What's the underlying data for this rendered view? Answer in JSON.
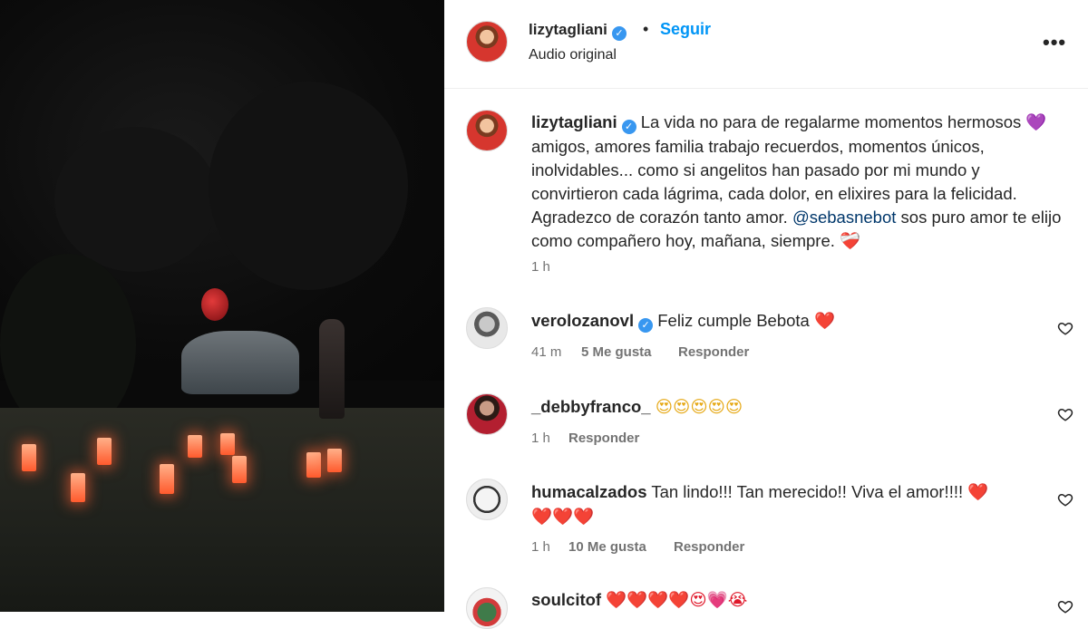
{
  "post": {
    "username": "lizytagliani",
    "follow_label": "Seguir",
    "separator": "•",
    "audio_label": "Audio original",
    "more_label": "•••",
    "caption_part1": "La vida no para de regalarme momentos hermosos",
    "caption_heart": "💜",
    "caption_part2": "amigos, amores familia trabajo recuerdos, momentos únicos, inolvidables... como si angelitos han pasado por mi mundo y convirtieron cada lágrima, cada dolor, en elixires para la felicidad. Agradezco de corazón tanto amor.",
    "caption_mention": "@sebasnebot",
    "caption_part3": "sos puro amor te elijo como compañero hoy, mañana, siempre.",
    "caption_end": "❤️‍🩹",
    "caption_time": "1 h"
  },
  "comments": [
    {
      "username": "verolozanovl",
      "verified": true,
      "text": "Feliz cumple Bebota",
      "emoji": "❤️",
      "time": "41 m",
      "likes": "5 Me gusta",
      "reply": "Responder"
    },
    {
      "username": "_debbyfranco_",
      "verified": false,
      "text": "",
      "emoji": "😍😍😍😍😍",
      "time": "1 h",
      "likes": "",
      "reply": "Responder"
    },
    {
      "username": "humacalzados",
      "verified": false,
      "text": "Tan lindo!!! Tan merecido!! Viva el amor!!!!",
      "emoji": "❤️",
      "emoji_line2": "❤️❤️❤️",
      "time": "1 h",
      "likes": "10 Me gusta",
      "reply": "Responder"
    },
    {
      "username": "soulcitof",
      "verified": false,
      "text": "",
      "emoji": "❤️❤️❤️❤️😍💗😭"
    }
  ],
  "icons": {
    "verified": "verified-badge-icon",
    "like": "heart-outline-icon",
    "more": "more-options-icon"
  },
  "colors": {
    "link": "#0095f6",
    "verified": "#3897f0",
    "muted": "#737373",
    "media_bg": "#0a0a0a"
  }
}
